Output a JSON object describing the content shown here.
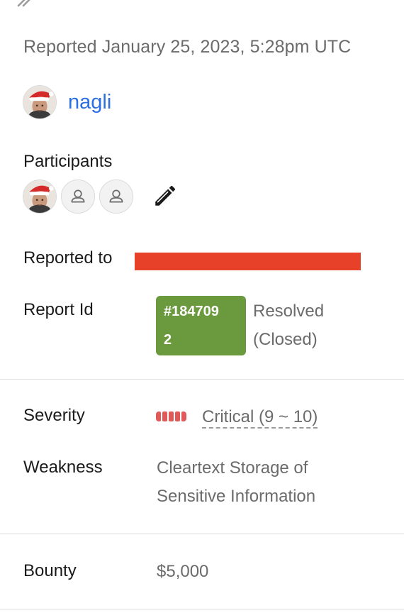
{
  "report": {
    "reported_line": "Reported January 25, 2023, 5:28pm UTC",
    "reporter": {
      "username": "nagli"
    },
    "participants_label": "Participants",
    "reported_to_label": "Reported to",
    "report_id_label": "Report Id",
    "report_id_line1": "#184709",
    "report_id_line2": "2",
    "status_line1": "Resolved",
    "status_line2": "(Closed)",
    "severity_label": "Severity",
    "severity_value": "Critical (9 ~ 10)",
    "weakness_label": "Weakness",
    "weakness_line1": "Cleartext Storage of",
    "weakness_line2": "Sensitive Information",
    "bounty_label": "Bounty",
    "bounty_value": "$5,000"
  },
  "colors": {
    "link": "#2d6fe0",
    "resolved_badge": "#6a9a3d",
    "critical": "#e15a5a",
    "redaction": "#e8412a"
  },
  "icons": {
    "corner": "double-slash-icon",
    "edit": "pencil-icon",
    "placeholder_avatar": "user-outline-icon"
  },
  "severity": {
    "filled_segments": 5,
    "total_segments": 5
  }
}
